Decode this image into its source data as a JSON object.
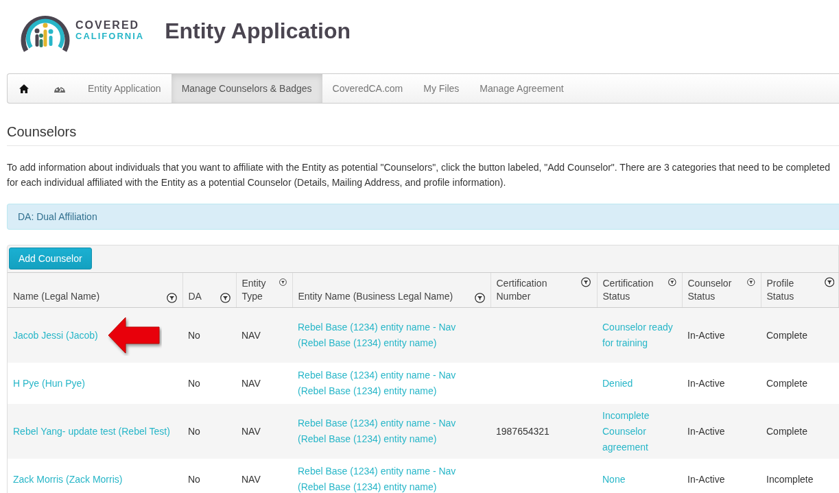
{
  "logo": {
    "line_1": "COVERED",
    "line_2": "CALIFORNIA"
  },
  "page_title": "Entity Application",
  "nav": [
    {
      "kind": "home",
      "selected": false
    },
    {
      "kind": "dashboard",
      "selected": false
    },
    {
      "kind": "text",
      "label": "Entity Application",
      "selected": false
    },
    {
      "kind": "text",
      "label": "Manage Counselors & Badges",
      "selected": true
    },
    {
      "kind": "text",
      "label": "CoveredCA.com",
      "selected": false
    },
    {
      "kind": "text",
      "label": "My Files",
      "selected": false
    },
    {
      "kind": "text",
      "label": "Manage Agreement",
      "selected": false
    }
  ],
  "section_title": "Counselors",
  "intro": "To add information about individuals that you want to affiliate with the Entity as potential \"Counselors\", click the button labeled, \"Add Counselor\". There are 3 categories that need to be completed for each individual affiliated with the Entity as a potential Counselor (Details, Mailing Address, and profile information).",
  "legend": "DA: Dual Affiliation",
  "add_button": "Add Counselor",
  "table": {
    "columns": [
      {
        "label": "Name (Legal Name)",
        "kind": "link"
      },
      {
        "label": "DA",
        "kind": "text"
      },
      {
        "label": "Entity Type",
        "kind": "text"
      },
      {
        "label": "Entity Name (Business Legal Name)",
        "kind": "link"
      },
      {
        "label": "Certification Number",
        "kind": "text"
      },
      {
        "label": "Certification Status",
        "kind": "link"
      },
      {
        "label": "Counselor Status",
        "kind": "text"
      },
      {
        "label": "Profile Status",
        "kind": "text"
      }
    ],
    "rows": [
      {
        "cells": [
          "Jacob Jessi (Jacob)",
          "No",
          "NAV",
          "Rebel Base (1234) entity name - Nav (Rebel Base (1234) entity name)",
          null,
          "Counselor ready for training",
          "In-Active",
          "Complete"
        ],
        "highlighted": true
      },
      {
        "cells": [
          "H Pye (Hun Pye)",
          "No",
          "NAV",
          "Rebel Base (1234) entity name - Nav (Rebel Base (1234) entity name)",
          null,
          "Denied",
          "In-Active",
          "Complete"
        ],
        "highlighted": false
      },
      {
        "cells": [
          "Rebel Yang- update test (Rebel Test)",
          "No",
          "NAV",
          "Rebel Base (1234) entity name - Nav (Rebel Base (1234) entity name)",
          "1987654321",
          "Incomplete Counselor agreement",
          "In-Active",
          "Complete"
        ],
        "highlighted": false
      },
      {
        "cells": [
          "Zack Morris (Zack Morris)",
          "No",
          "NAV",
          "Rebel Base (1234) entity name - Nav (Rebel Base (1234) entity name)",
          null,
          "None",
          "In-Active",
          "Incomplete"
        ],
        "highlighted": false
      }
    ]
  }
}
